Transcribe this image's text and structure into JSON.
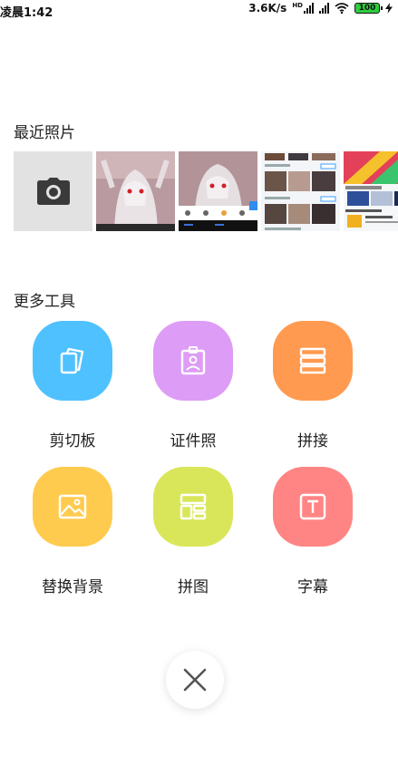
{
  "status_bar": {
    "time": "凌晨1:42",
    "network_speed": "3.6K/s",
    "signal_badge": "HD",
    "battery_level": "100"
  },
  "recent": {
    "title": "最近照片",
    "camera_icon": "camera-icon"
  },
  "tools": {
    "title": "更多工具",
    "items": [
      {
        "label": "剪切板",
        "icon": "clipboard-icon",
        "color": "#4fc1ff"
      },
      {
        "label": "证件照",
        "icon": "id-photo-icon",
        "color": "#dd9cf5"
      },
      {
        "label": "拼接",
        "icon": "stitch-icon",
        "color": "#ff9a50"
      },
      {
        "label": "替换背景",
        "icon": "replace-background-icon",
        "color": "#ffcb4e"
      },
      {
        "label": "拼图",
        "icon": "collage-icon",
        "color": "#d9e65a"
      },
      {
        "label": "字幕",
        "icon": "subtitle-icon",
        "color": "#ff8585"
      }
    ]
  },
  "close_icon": "close-icon"
}
